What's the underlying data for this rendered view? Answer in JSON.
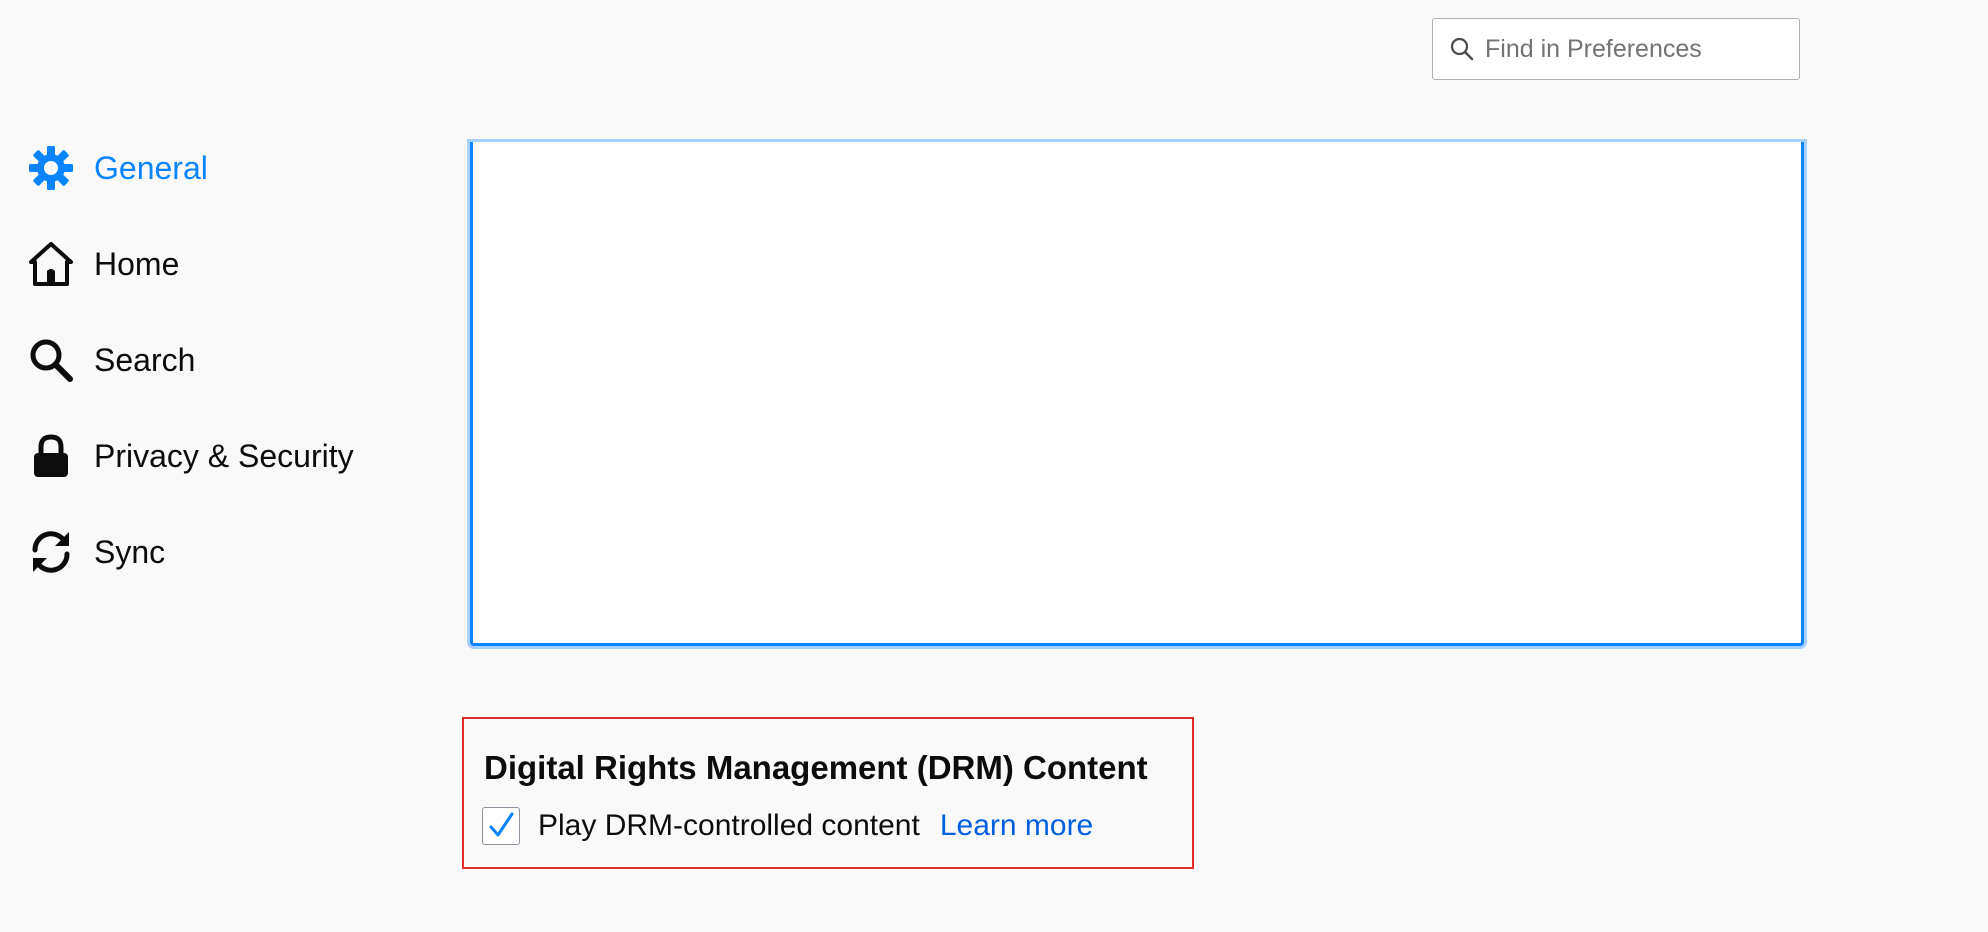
{
  "search": {
    "placeholder": "Find in Preferences",
    "value": ""
  },
  "sidebar": {
    "items": [
      {
        "label": "General",
        "icon": "gear-icon",
        "selected": true
      },
      {
        "label": "Home",
        "icon": "home-icon",
        "selected": false
      },
      {
        "label": "Search",
        "icon": "magnifier-icon",
        "selected": false
      },
      {
        "label": "Privacy & Security",
        "icon": "lock-icon",
        "selected": false
      },
      {
        "label": "Sync",
        "icon": "sync-icon",
        "selected": false
      }
    ]
  },
  "drm": {
    "title": "Digital Rights Management (DRM) Content",
    "checkbox_label": "Play DRM-controlled content",
    "checked": true,
    "learn_more": "Learn more"
  },
  "colors": {
    "accent": "#0a84ff",
    "link": "#0060df",
    "highlight_box": "#e22b2b",
    "checkmark": "#0a84ff"
  }
}
